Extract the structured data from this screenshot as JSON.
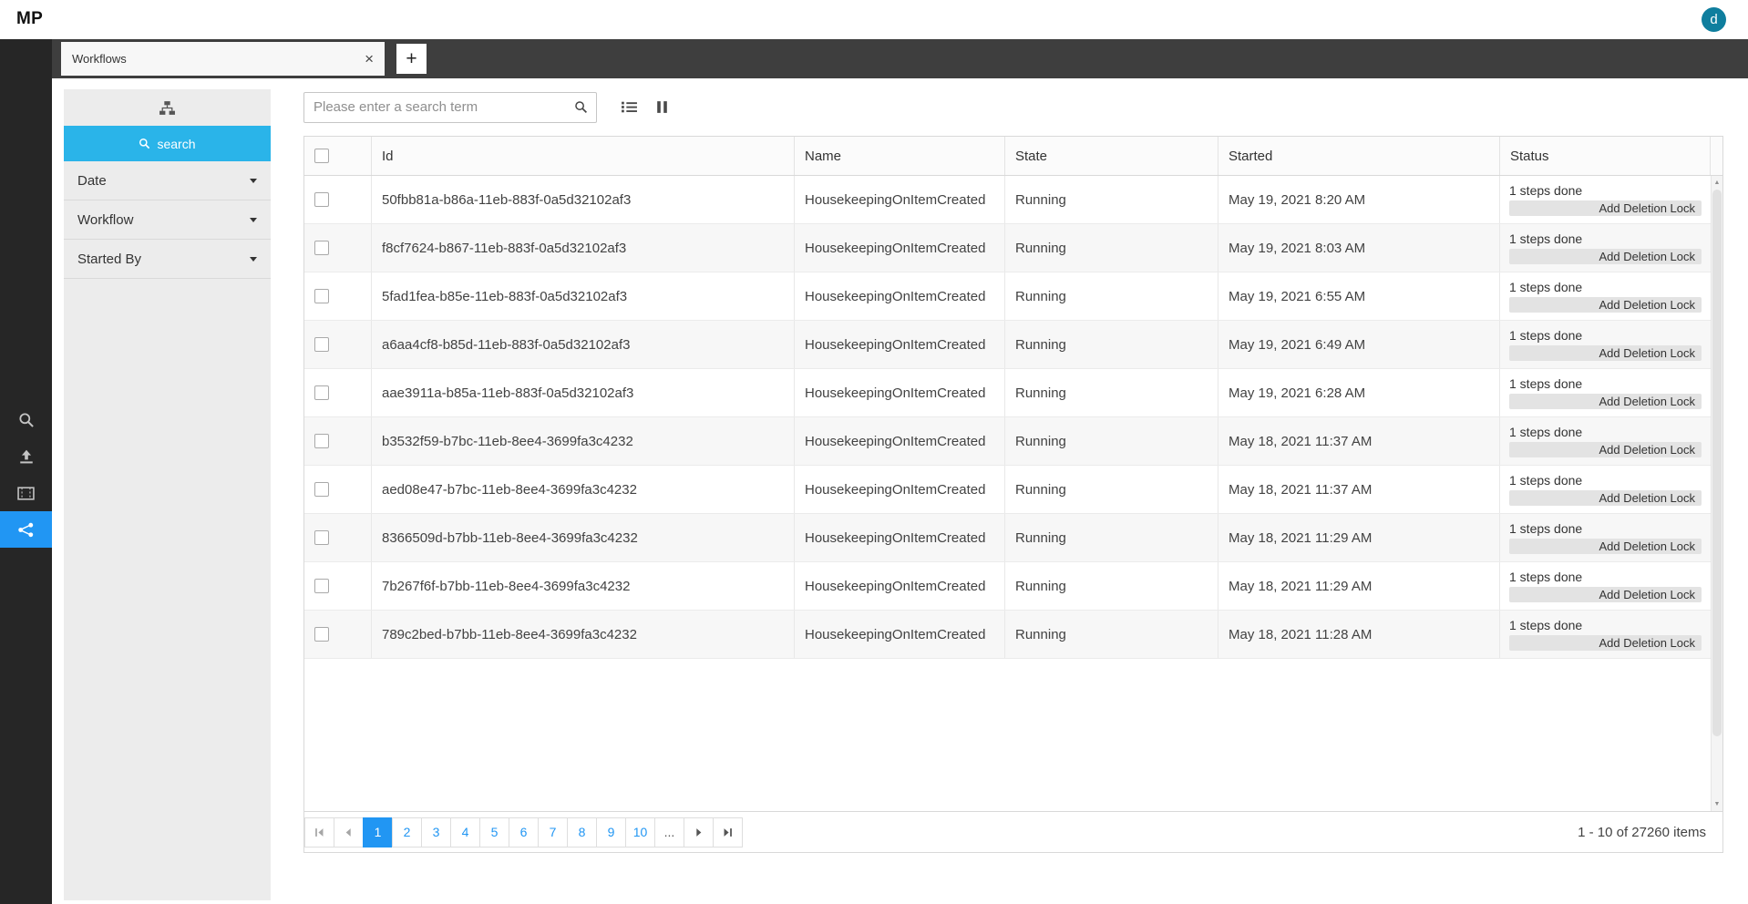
{
  "colors": {
    "accent": "#2196f3",
    "search_button": "#2ab4e9",
    "avatar_bg": "#0f7e9e"
  },
  "topbar": {
    "logo": "MP",
    "avatar": "d"
  },
  "tabbar": {
    "tabs": [
      {
        "label": "Workflows",
        "close_glyph": "×"
      }
    ],
    "new_tab_glyph": "+"
  },
  "filter_panel": {
    "search_label": "search",
    "sections": [
      {
        "label": "Date"
      },
      {
        "label": "Workflow"
      },
      {
        "label": "Started By"
      }
    ]
  },
  "toolbar": {
    "search_placeholder": "Please enter a search term"
  },
  "table": {
    "columns": [
      "Id",
      "Name",
      "State",
      "Started",
      "Status"
    ],
    "rows": [
      {
        "id": "50fbb81a-b86a-11eb-883f-0a5d32102af3",
        "name": "HousekeepingOnItemCreated",
        "state": "Running",
        "started": "May 19, 2021 8:20 AM",
        "steps": "1 steps done",
        "action": "Add Deletion Lock"
      },
      {
        "id": "f8cf7624-b867-11eb-883f-0a5d32102af3",
        "name": "HousekeepingOnItemCreated",
        "state": "Running",
        "started": "May 19, 2021 8:03 AM",
        "steps": "1 steps done",
        "action": "Add Deletion Lock"
      },
      {
        "id": "5fad1fea-b85e-11eb-883f-0a5d32102af3",
        "name": "HousekeepingOnItemCreated",
        "state": "Running",
        "started": "May 19, 2021 6:55 AM",
        "steps": "1 steps done",
        "action": "Add Deletion Lock"
      },
      {
        "id": "a6aa4cf8-b85d-11eb-883f-0a5d32102af3",
        "name": "HousekeepingOnItemCreated",
        "state": "Running",
        "started": "May 19, 2021 6:49 AM",
        "steps": "1 steps done",
        "action": "Add Deletion Lock"
      },
      {
        "id": "aae3911a-b85a-11eb-883f-0a5d32102af3",
        "name": "HousekeepingOnItemCreated",
        "state": "Running",
        "started": "May 19, 2021 6:28 AM",
        "steps": "1 steps done",
        "action": "Add Deletion Lock"
      },
      {
        "id": "b3532f59-b7bc-11eb-8ee4-3699fa3c4232",
        "name": "HousekeepingOnItemCreated",
        "state": "Running",
        "started": "May 18, 2021 11:37 AM",
        "steps": "1 steps done",
        "action": "Add Deletion Lock"
      },
      {
        "id": "aed08e47-b7bc-11eb-8ee4-3699fa3c4232",
        "name": "HousekeepingOnItemCreated",
        "state": "Running",
        "started": "May 18, 2021 11:37 AM",
        "steps": "1 steps done",
        "action": "Add Deletion Lock"
      },
      {
        "id": "8366509d-b7bb-11eb-8ee4-3699fa3c4232",
        "name": "HousekeepingOnItemCreated",
        "state": "Running",
        "started": "May 18, 2021 11:29 AM",
        "steps": "1 steps done",
        "action": "Add Deletion Lock"
      },
      {
        "id": "7b267f6f-b7bb-11eb-8ee4-3699fa3c4232",
        "name": "HousekeepingOnItemCreated",
        "state": "Running",
        "started": "May 18, 2021 11:29 AM",
        "steps": "1 steps done",
        "action": "Add Deletion Lock"
      },
      {
        "id": "789c2bed-b7bb-11eb-8ee4-3699fa3c4232",
        "name": "HousekeepingOnItemCreated",
        "state": "Running",
        "started": "May 18, 2021 11:28 AM",
        "steps": "1 steps done",
        "action": "Add Deletion Lock"
      }
    ]
  },
  "pagination": {
    "pages": [
      "1",
      "2",
      "3",
      "4",
      "5",
      "6",
      "7",
      "8",
      "9",
      "10",
      "..."
    ],
    "current": "1",
    "info": "1 - 10 of 27260 items"
  }
}
